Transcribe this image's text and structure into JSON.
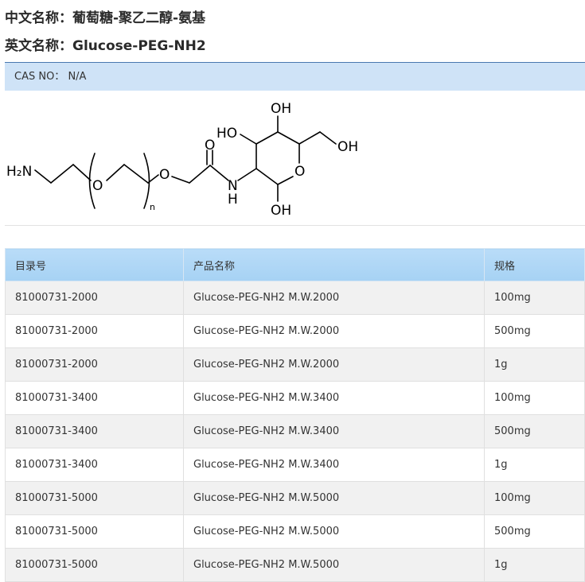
{
  "header": {
    "cn_label": "中文名称：",
    "cn_name": "葡萄糖-聚乙二醇-氨基",
    "en_label": "英文名称：",
    "en_name": "Glucose-PEG-NH2"
  },
  "cas": {
    "label": "CAS NO：",
    "value": "N/A"
  },
  "structure": {
    "labels": {
      "amine": "H₂N",
      "ether_o1": "O",
      "ether_o2": "O",
      "repeat": "n",
      "carbonyl_o": "O",
      "amide_n": "N",
      "amide_h": "H",
      "ring_o": "O",
      "oh_top": "OH",
      "oh_left": "HO",
      "oh_right": "OH",
      "oh_bottom": "OH"
    }
  },
  "table": {
    "columns": [
      "目录号",
      "产品名称",
      "规格"
    ],
    "rows": [
      [
        "81000731-2000",
        "Glucose-PEG-NH2 M.W.2000",
        "100mg"
      ],
      [
        "81000731-2000",
        "Glucose-PEG-NH2 M.W.2000",
        "500mg"
      ],
      [
        "81000731-2000",
        "Glucose-PEG-NH2 M.W.2000",
        "1g"
      ],
      [
        "81000731-3400",
        "Glucose-PEG-NH2 M.W.3400",
        "100mg"
      ],
      [
        "81000731-3400",
        "Glucose-PEG-NH2 M.W.3400",
        "500mg"
      ],
      [
        "81000731-3400",
        "Glucose-PEG-NH2 M.W.3400",
        "1g"
      ],
      [
        "81000731-5000",
        "Glucose-PEG-NH2 M.W.5000",
        "100mg"
      ],
      [
        "81000731-5000",
        "Glucose-PEG-NH2 M.W.5000",
        "500mg"
      ],
      [
        "81000731-5000",
        "Glucose-PEG-NH2 M.W.5000",
        "1g"
      ]
    ]
  }
}
